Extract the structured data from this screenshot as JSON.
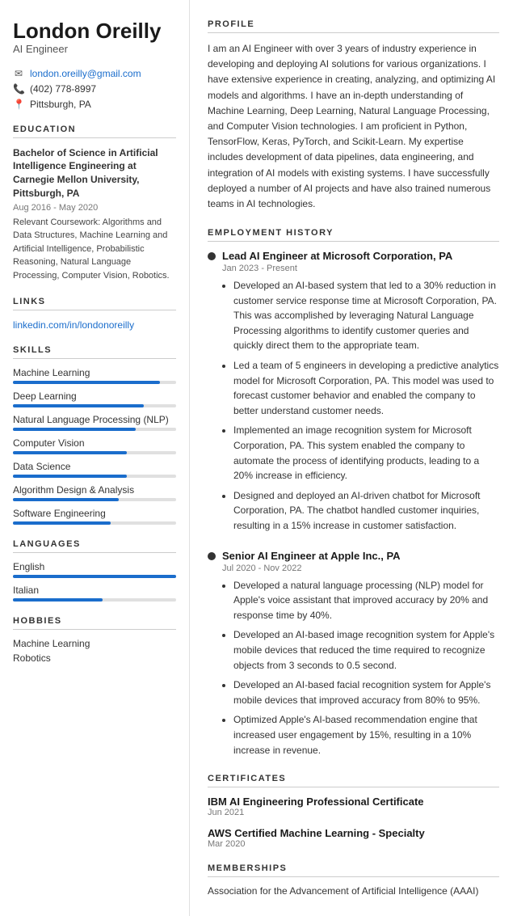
{
  "sidebar": {
    "name": "London Oreilly",
    "title": "AI Engineer",
    "contact": {
      "email": "london.oreilly@gmail.com",
      "phone": "(402) 778-8997",
      "location": "Pittsburgh, PA"
    },
    "education": {
      "section_label": "Education",
      "degree": "Bachelor of Science in Artificial Intelligence Engineering at Carnegie Mellon University, Pittsburgh, PA",
      "dates": "Aug 2016 - May 2020",
      "coursework_label": "Relevant Coursework:",
      "coursework": "Algorithms and Data Structures, Machine Learning and Artificial Intelligence, Probabilistic Reasoning, Natural Language Processing, Computer Vision, Robotics."
    },
    "links": {
      "section_label": "Links",
      "linkedin": "linkedin.com/in/londonoreilly",
      "linkedin_href": "#"
    },
    "skills": {
      "section_label": "Skills",
      "items": [
        {
          "label": "Machine Learning",
          "pct": 90
        },
        {
          "label": "Deep Learning",
          "pct": 80
        },
        {
          "label": "Natural Language Processing (NLP)",
          "pct": 75
        },
        {
          "label": "Computer Vision",
          "pct": 70
        },
        {
          "label": "Data Science",
          "pct": 70
        },
        {
          "label": "Algorithm Design & Analysis",
          "pct": 65
        },
        {
          "label": "Software Engineering",
          "pct": 60
        }
      ]
    },
    "languages": {
      "section_label": "Languages",
      "items": [
        {
          "label": "English",
          "pct": 100
        },
        {
          "label": "Italian",
          "pct": 55
        }
      ]
    },
    "hobbies": {
      "section_label": "Hobbies",
      "items": [
        "Machine Learning",
        "Robotics"
      ]
    }
  },
  "main": {
    "profile": {
      "section_label": "Profile",
      "text": "I am an AI Engineer with over 3 years of industry experience in developing and deploying AI solutions for various organizations. I have extensive experience in creating, analyzing, and optimizing AI models and algorithms. I have an in-depth understanding of Machine Learning, Deep Learning, Natural Language Processing, and Computer Vision technologies. I am proficient in Python, TensorFlow, Keras, PyTorch, and Scikit-Learn. My expertise includes development of data pipelines, data engineering, and integration of AI models with existing systems. I have successfully deployed a number of AI projects and have also trained numerous teams in AI technologies."
    },
    "employment": {
      "section_label": "Employment History",
      "jobs": [
        {
          "title": "Lead AI Engineer at Microsoft Corporation, PA",
          "dates": "Jan 2023 - Present",
          "bullets": [
            "Developed an AI-based system that led to a 30% reduction in customer service response time at Microsoft Corporation, PA. This was accomplished by leveraging Natural Language Processing algorithms to identify customer queries and quickly direct them to the appropriate team.",
            "Led a team of 5 engineers in developing a predictive analytics model for Microsoft Corporation, PA. This model was used to forecast customer behavior and enabled the company to better understand customer needs.",
            "Implemented an image recognition system for Microsoft Corporation, PA. This system enabled the company to automate the process of identifying products, leading to a 20% increase in efficiency.",
            "Designed and deployed an AI-driven chatbot for Microsoft Corporation, PA. The chatbot handled customer inquiries, resulting in a 15% increase in customer satisfaction."
          ]
        },
        {
          "title": "Senior AI Engineer at Apple Inc., PA",
          "dates": "Jul 2020 - Nov 2022",
          "bullets": [
            "Developed a natural language processing (NLP) model for Apple's voice assistant that improved accuracy by 20% and response time by 40%.",
            "Developed an AI-based image recognition system for Apple's mobile devices that reduced the time required to recognize objects from 3 seconds to 0.5 second.",
            "Developed an AI-based facial recognition system for Apple's mobile devices that improved accuracy from 80% to 95%.",
            "Optimized Apple's AI-based recommendation engine that increased user engagement by 15%, resulting in a 10% increase in revenue."
          ]
        }
      ]
    },
    "certificates": {
      "section_label": "Certificates",
      "items": [
        {
          "name": "IBM AI Engineering Professional Certificate",
          "date": "Jun 2021"
        },
        {
          "name": "AWS Certified Machine Learning - Specialty",
          "date": "Mar 2020"
        }
      ]
    },
    "memberships": {
      "section_label": "Memberships",
      "items": [
        {
          "name": "Association for the Advancement of Artificial Intelligence (AAAI)"
        }
      ]
    }
  }
}
